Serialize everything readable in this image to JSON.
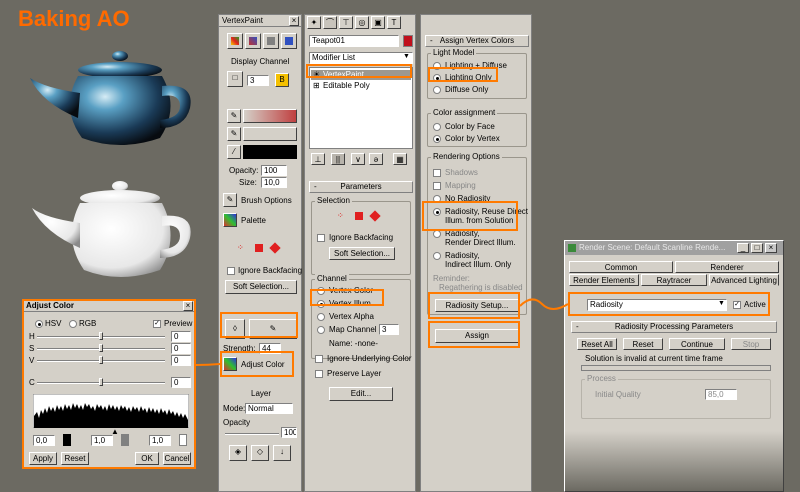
{
  "page_title": "Baking AO",
  "vertexpaint": {
    "title": "VertexPaint",
    "display_channel": "Display Channel",
    "channel_value": "3",
    "opacity_label": "Opacity:",
    "opacity_value": "100",
    "size_label": "Size:",
    "size_value": "10,0",
    "brush_options": "Brush Options",
    "palette": "Palette",
    "ignore_backfacing": "Ignore Backfacing",
    "soft_selection": "Soft Selection...",
    "strength_label": "Strength:",
    "strength_value": "44",
    "adjust_color": "Adjust Color",
    "layer": "Layer",
    "mode_label": "Mode:",
    "mode_value": "Normal",
    "opacity_layer": "Opacity",
    "opacity_layer_value": "100",
    "accent_color": "#ff7a00"
  },
  "modifier": {
    "object_name": "Teapot01",
    "modifier_list": "Modifier List",
    "stack": [
      "VertexPaint",
      "Editable Poly"
    ]
  },
  "parameters": {
    "title": "Parameters",
    "selection_group": "Selection",
    "ignore_backfacing": "Ignore Backfacing",
    "soft_selection": "Soft Selection...",
    "channel_group": "Channel",
    "vertex_color": "Vertex Color",
    "vertex_illum": "Vertex Illum",
    "vertex_alpha": "Vertex Alpha",
    "map_channel": "Map Channel",
    "map_channel_value": "3",
    "name_label": "Name:  -none-",
    "ignore_underlying": "Ignore Underlying Color",
    "preserve_layer": "Preserve Layer",
    "edit": "Edit..."
  },
  "assign_vertex_colors": {
    "title": "Assign Vertex Colors",
    "light_model": "Light Model",
    "lighting_diffuse": "Lighting + Diffuse",
    "lighting_only": "Lighting Only",
    "diffuse_only": "Diffuse Only",
    "color_assignment": "Color assignment",
    "color_by_face": "Color by Face",
    "color_by_vertex": "Color by Vertex",
    "rendering_options": "Rendering Options",
    "shadows": "Shadows",
    "mapping": "Mapping",
    "no_radiosity": "No Radiosity",
    "radiosity_reuse_1": "Radiosity, Reuse Direct",
    "radiosity_reuse_2": "Illum. from Solution",
    "radiosity_render_1": "Radiosity,",
    "radiosity_render_2": "Render Direct Illum.",
    "radiosity_indirect_1": "Radiosity,",
    "radiosity_indirect_2": "Indirect Illum. Only",
    "reminder_1": "Reminder:",
    "reminder_2": "Regathering is disabled",
    "radiosity_setup": "Radiosity Setup...",
    "assign": "Assign"
  },
  "adjust_color": {
    "title": "Adjust Color",
    "hsv": "HSV",
    "rgb": "RGB",
    "preview": "Preview",
    "channels": [
      "H",
      "S",
      "V",
      "C"
    ],
    "values": [
      "0",
      "0",
      "0",
      "0"
    ],
    "levels": [
      "0,0",
      "1,0",
      "1,0"
    ],
    "apply": "Apply",
    "reset": "Reset",
    "ok": "OK",
    "cancel": "Cancel"
  },
  "render_scene": {
    "title": "Render Scene: Default Scanline Rende...",
    "tabs_top": [
      "Common",
      "Renderer"
    ],
    "tabs_bottom": [
      "Render Elements",
      "Raytracer",
      "Advanced Lighting"
    ],
    "dropdown_value": "Radiosity",
    "active": "Active",
    "rollout_title": "Radiosity Processing Parameters",
    "reset_all": "Reset All",
    "reset": "Reset",
    "continue": "Continue",
    "stop": "Stop",
    "solution_status": "Solution is invalid at current time frame",
    "process": "Process",
    "initial_quality": "Initial Quality",
    "initial_quality_value": "85,0"
  }
}
